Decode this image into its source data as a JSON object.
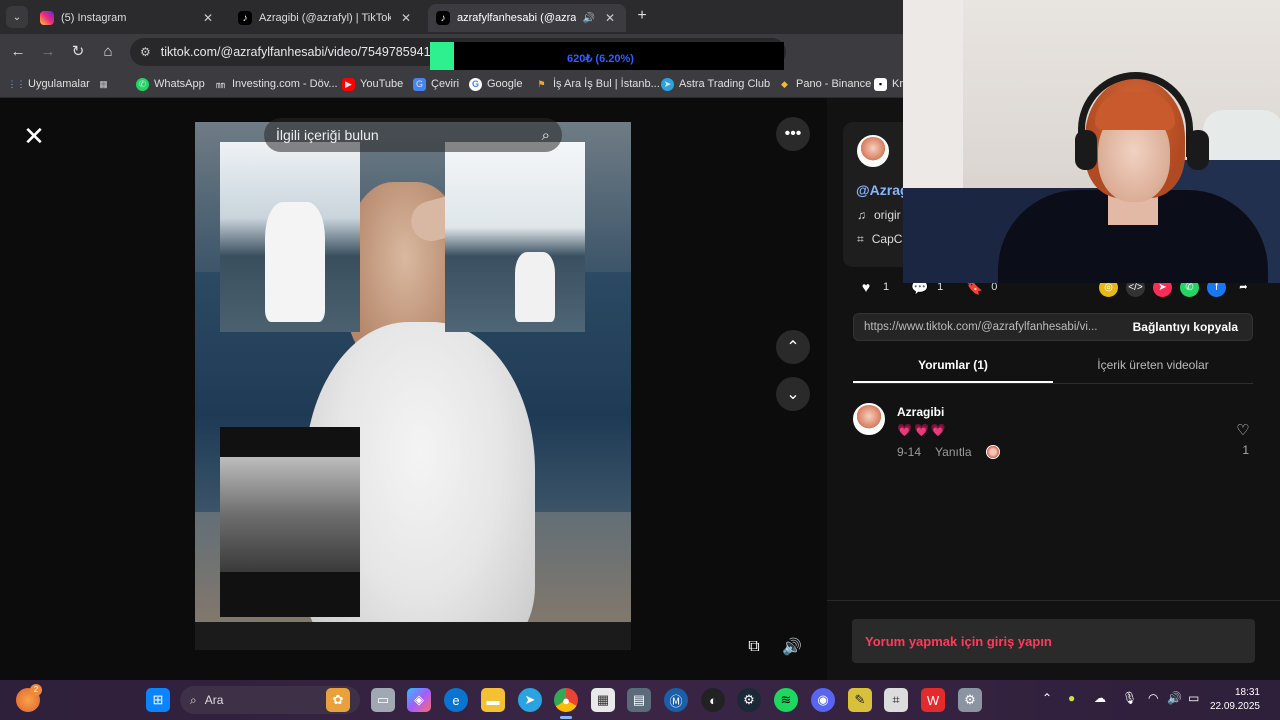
{
  "browser": {
    "tabs": [
      {
        "title": "(5) Instagram",
        "icon": "instagram-icon"
      },
      {
        "title": "Azragibi (@azrafyl) | TikTok",
        "icon": "tiktok-icon"
      },
      {
        "title": "azrafylfanhesabi (@azrafylfa",
        "icon": "tiktok-icon",
        "active": true
      }
    ],
    "url": "tiktok.com/@azrafylfanhesabi/video/7549785941351",
    "overlay_text": "620₺ (6.20%)",
    "bookmarks": [
      {
        "label": "Uygulamalar",
        "icon": "apps-grid-icon"
      },
      {
        "label": "",
        "icon": "grid-icon"
      },
      {
        "label": "WhatsApp",
        "icon": "whatsapp-icon"
      },
      {
        "label": "Investing.com - Döv...",
        "icon": "investing-icon"
      },
      {
        "label": "YouTube",
        "icon": "youtube-icon"
      },
      {
        "label": "Çeviri",
        "icon": "translate-icon"
      },
      {
        "label": "Google",
        "icon": "google-icon"
      },
      {
        "label": "İş Ara İş Bul | İstanb...",
        "icon": "job-icon"
      },
      {
        "label": "Astra Trading Club",
        "icon": "telegram-icon"
      },
      {
        "label": "Pano - Binance",
        "icon": "binance-icon"
      },
      {
        "label": "Kr",
        "icon": "bookmark-icon"
      }
    ]
  },
  "video": {
    "search_placeholder": "İlgili içeriği bulun"
  },
  "side": {
    "handle": "@Azrag",
    "music": "origir",
    "capcut": "CapC",
    "stats": {
      "likes": "1",
      "comments": "1",
      "saves": "0"
    },
    "share_link": "https://www.tiktok.com/@azrafylfanhesabi/vi...",
    "copy_label": "Bağlantıyı kopyala",
    "tabs": [
      "Yorumlar (1)",
      "İçerik üreten videolar"
    ],
    "comment": {
      "author": "Azragibi",
      "text": "💗💗💗",
      "date": "9-14",
      "reply": "Yanıtla",
      "likes": "1"
    },
    "login_prompt": "Yorum yapmak için giriş yapın"
  },
  "taskbar": {
    "search_label": "Ara",
    "time": "18:31",
    "date": "22.09.2025",
    "notif_count": "2"
  }
}
